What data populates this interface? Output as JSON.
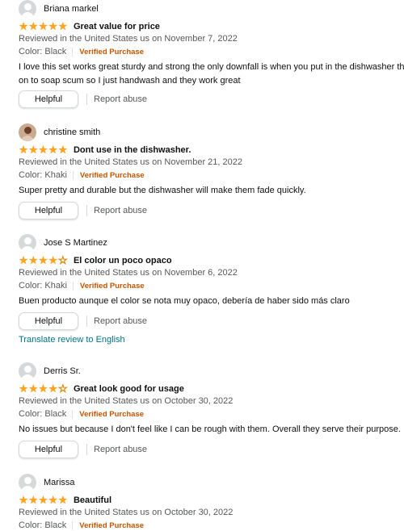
{
  "reviews": [
    {
      "reviewer": "Briana markel",
      "avatar": "default-avatar-icon",
      "rating": 5,
      "title": "Great value for price",
      "date": "Reviewed in the United States us on November 7, 2022",
      "color": "Color: Black",
      "verified": "Verified Purchase",
      "body_lines": [
        "I love this set works great sturdy and strong the only downfall is when you put in the dishwasher they hold",
        "on to soap scum so I just handwash and they work great"
      ],
      "helpful": "Helpful",
      "report": "Report abuse"
    },
    {
      "reviewer": "christine smith",
      "avatar": "profile-photo-icon",
      "rating": 5,
      "title": "Dont use in the dishwasher.",
      "date": "Reviewed in the United States us on November 21, 2022",
      "color": "Color: Khaki",
      "verified": "Verified Purchase",
      "body_lines": [
        "Super pretty and durable but the dishwasher will make them fade quickly."
      ],
      "helpful": "Helpful",
      "report": "Report abuse"
    },
    {
      "reviewer": "Jose S Martinez",
      "avatar": "default-avatar-icon",
      "rating": 4,
      "title": "El color un poco opaco",
      "date": "Reviewed in the United States us on November 6, 2022",
      "color": "Color: Khaki",
      "verified": "Verified Purchase",
      "body_lines": [
        "Buen producto aunque el color se nota muy opaco, debería de haber sido más claro"
      ],
      "helpful": "Helpful",
      "report": "Report abuse",
      "translate": "Translate review to English"
    },
    {
      "reviewer": "Derris Sr.",
      "avatar": "default-avatar-icon",
      "rating": 4,
      "title": "Great look good for usage",
      "date": "Reviewed in the United States us on October 30, 2022",
      "color": "Color: Black",
      "verified": "Verified Purchase",
      "body_lines": [
        "No issues but because I don't feel like I can be rough with them. Overall they serve their purpose."
      ],
      "helpful": "Helpful",
      "report": "Report abuse"
    },
    {
      "reviewer": "Marissa",
      "avatar": "default-avatar-icon",
      "rating": 5,
      "title": "Beautiful",
      "date": "Reviewed in the United States us on October 30, 2022",
      "color": "Color: Black",
      "verified": "Verified Purchase",
      "body_lines": [],
      "helpful": "",
      "report": ""
    }
  ]
}
